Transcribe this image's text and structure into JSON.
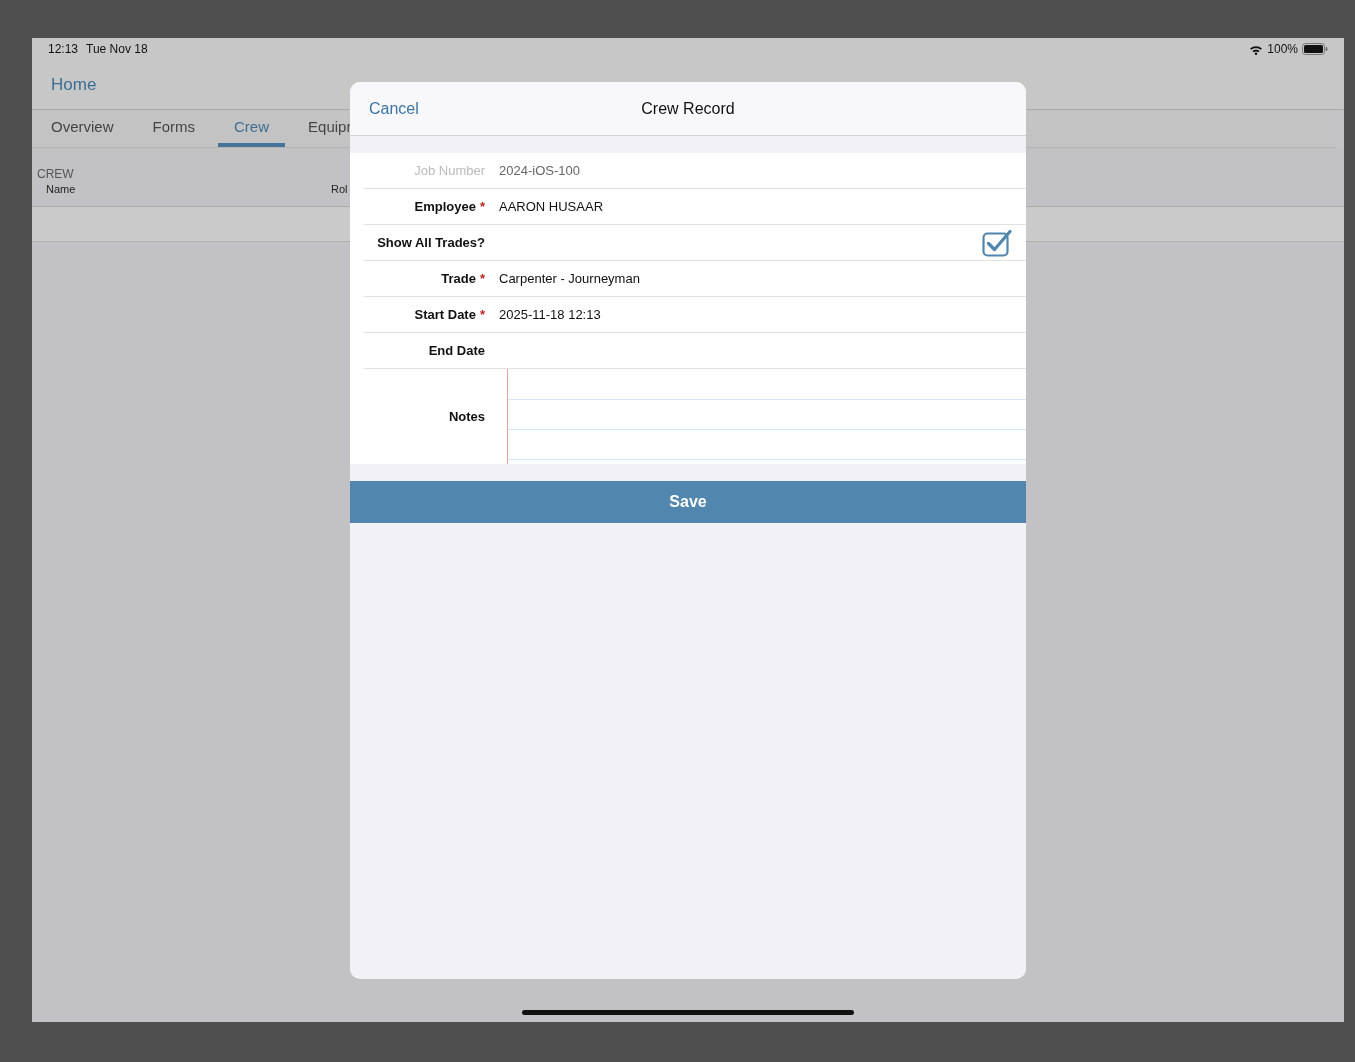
{
  "status_bar": {
    "time": "12:13",
    "date": "Tue Nov 18",
    "battery": "100%"
  },
  "nav": {
    "back": "Home"
  },
  "tabs": [
    {
      "label": "Overview",
      "selected": false
    },
    {
      "label": "Forms",
      "selected": false
    },
    {
      "label": "Crew",
      "selected": true
    },
    {
      "label": "Equipr",
      "selected": false
    }
  ],
  "crew": {
    "section": "CREW",
    "columns": [
      "Name",
      "Rol"
    ]
  },
  "modal": {
    "cancel": "Cancel",
    "title": "Crew Record",
    "fields": [
      {
        "kind": "text",
        "label": "Job Number",
        "value": "2024-iOS-100",
        "disabled": true
      },
      {
        "kind": "text",
        "label": "Employee",
        "required_mark": "*",
        "value": "AARON HUSAAR",
        "disabled": false
      },
      {
        "kind": "checkbox",
        "label": "Show All Trades?",
        "checked": true,
        "disabled": false
      },
      {
        "kind": "text",
        "label": "Trade",
        "required_mark": "*",
        "value": "Carpenter - Journeyman",
        "disabled": false
      },
      {
        "kind": "text",
        "label": "Start Date",
        "required_mark": "*",
        "value": "2025-11-18 12:13",
        "disabled": false
      },
      {
        "kind": "text",
        "label": "End Date",
        "disabled": false
      },
      {
        "kind": "notes",
        "label": "Notes",
        "disabled": false
      }
    ],
    "save": "Save"
  }
}
